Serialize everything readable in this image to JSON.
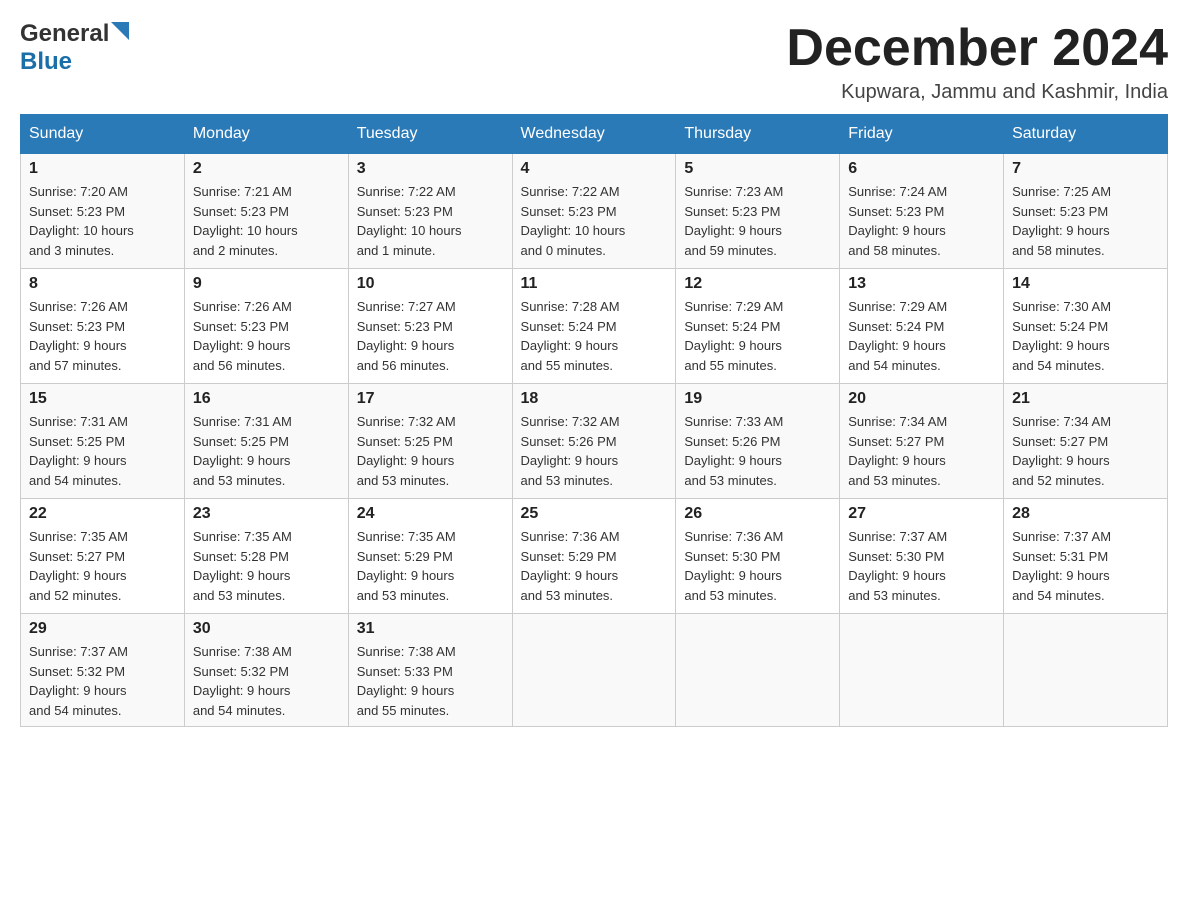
{
  "header": {
    "logo_general": "General",
    "logo_blue": "Blue",
    "month_title": "December 2024",
    "location": "Kupwara, Jammu and Kashmir, India"
  },
  "weekdays": [
    "Sunday",
    "Monday",
    "Tuesday",
    "Wednesday",
    "Thursday",
    "Friday",
    "Saturday"
  ],
  "weeks": [
    [
      {
        "day": "1",
        "sunrise": "7:20 AM",
        "sunset": "5:23 PM",
        "daylight": "10 hours and 3 minutes."
      },
      {
        "day": "2",
        "sunrise": "7:21 AM",
        "sunset": "5:23 PM",
        "daylight": "10 hours and 2 minutes."
      },
      {
        "day": "3",
        "sunrise": "7:22 AM",
        "sunset": "5:23 PM",
        "daylight": "10 hours and 1 minute."
      },
      {
        "day": "4",
        "sunrise": "7:22 AM",
        "sunset": "5:23 PM",
        "daylight": "10 hours and 0 minutes."
      },
      {
        "day": "5",
        "sunrise": "7:23 AM",
        "sunset": "5:23 PM",
        "daylight": "9 hours and 59 minutes."
      },
      {
        "day": "6",
        "sunrise": "7:24 AM",
        "sunset": "5:23 PM",
        "daylight": "9 hours and 58 minutes."
      },
      {
        "day": "7",
        "sunrise": "7:25 AM",
        "sunset": "5:23 PM",
        "daylight": "9 hours and 58 minutes."
      }
    ],
    [
      {
        "day": "8",
        "sunrise": "7:26 AM",
        "sunset": "5:23 PM",
        "daylight": "9 hours and 57 minutes."
      },
      {
        "day": "9",
        "sunrise": "7:26 AM",
        "sunset": "5:23 PM",
        "daylight": "9 hours and 56 minutes."
      },
      {
        "day": "10",
        "sunrise": "7:27 AM",
        "sunset": "5:23 PM",
        "daylight": "9 hours and 56 minutes."
      },
      {
        "day": "11",
        "sunrise": "7:28 AM",
        "sunset": "5:24 PM",
        "daylight": "9 hours and 55 minutes."
      },
      {
        "day": "12",
        "sunrise": "7:29 AM",
        "sunset": "5:24 PM",
        "daylight": "9 hours and 55 minutes."
      },
      {
        "day": "13",
        "sunrise": "7:29 AM",
        "sunset": "5:24 PM",
        "daylight": "9 hours and 54 minutes."
      },
      {
        "day": "14",
        "sunrise": "7:30 AM",
        "sunset": "5:24 PM",
        "daylight": "9 hours and 54 minutes."
      }
    ],
    [
      {
        "day": "15",
        "sunrise": "7:31 AM",
        "sunset": "5:25 PM",
        "daylight": "9 hours and 54 minutes."
      },
      {
        "day": "16",
        "sunrise": "7:31 AM",
        "sunset": "5:25 PM",
        "daylight": "9 hours and 53 minutes."
      },
      {
        "day": "17",
        "sunrise": "7:32 AM",
        "sunset": "5:25 PM",
        "daylight": "9 hours and 53 minutes."
      },
      {
        "day": "18",
        "sunrise": "7:32 AM",
        "sunset": "5:26 PM",
        "daylight": "9 hours and 53 minutes."
      },
      {
        "day": "19",
        "sunrise": "7:33 AM",
        "sunset": "5:26 PM",
        "daylight": "9 hours and 53 minutes."
      },
      {
        "day": "20",
        "sunrise": "7:34 AM",
        "sunset": "5:27 PM",
        "daylight": "9 hours and 53 minutes."
      },
      {
        "day": "21",
        "sunrise": "7:34 AM",
        "sunset": "5:27 PM",
        "daylight": "9 hours and 52 minutes."
      }
    ],
    [
      {
        "day": "22",
        "sunrise": "7:35 AM",
        "sunset": "5:27 PM",
        "daylight": "9 hours and 52 minutes."
      },
      {
        "day": "23",
        "sunrise": "7:35 AM",
        "sunset": "5:28 PM",
        "daylight": "9 hours and 53 minutes."
      },
      {
        "day": "24",
        "sunrise": "7:35 AM",
        "sunset": "5:29 PM",
        "daylight": "9 hours and 53 minutes."
      },
      {
        "day": "25",
        "sunrise": "7:36 AM",
        "sunset": "5:29 PM",
        "daylight": "9 hours and 53 minutes."
      },
      {
        "day": "26",
        "sunrise": "7:36 AM",
        "sunset": "5:30 PM",
        "daylight": "9 hours and 53 minutes."
      },
      {
        "day": "27",
        "sunrise": "7:37 AM",
        "sunset": "5:30 PM",
        "daylight": "9 hours and 53 minutes."
      },
      {
        "day": "28",
        "sunrise": "7:37 AM",
        "sunset": "5:31 PM",
        "daylight": "9 hours and 54 minutes."
      }
    ],
    [
      {
        "day": "29",
        "sunrise": "7:37 AM",
        "sunset": "5:32 PM",
        "daylight": "9 hours and 54 minutes."
      },
      {
        "day": "30",
        "sunrise": "7:38 AM",
        "sunset": "5:32 PM",
        "daylight": "9 hours and 54 minutes."
      },
      {
        "day": "31",
        "sunrise": "7:38 AM",
        "sunset": "5:33 PM",
        "daylight": "9 hours and 55 minutes."
      },
      null,
      null,
      null,
      null
    ]
  ],
  "labels": {
    "sunrise": "Sunrise:",
    "sunset": "Sunset:",
    "daylight": "Daylight:"
  }
}
